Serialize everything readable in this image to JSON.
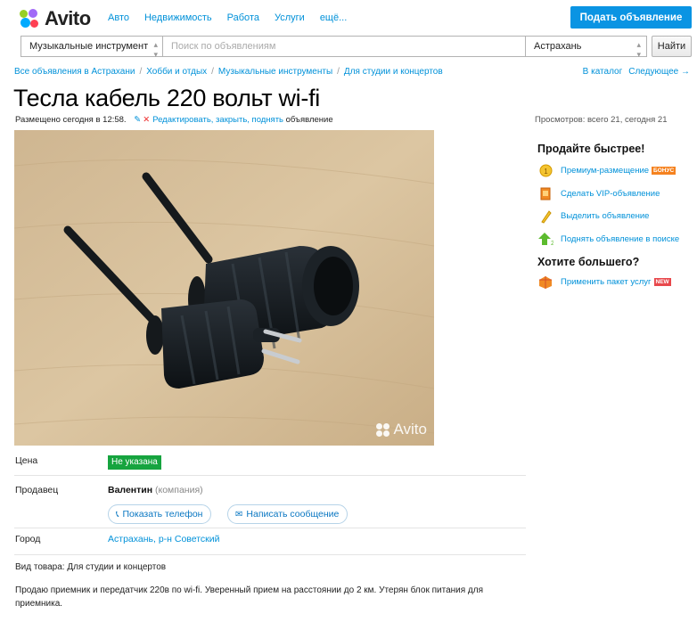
{
  "header": {
    "logo_text": "Avito",
    "nav": [
      "Авто",
      "Недвижимость",
      "Работа",
      "Услуги",
      "ещё..."
    ],
    "post_button": "Подать объявление",
    "colors": {
      "accent": "#0a94e3",
      "link": "#0091d9"
    }
  },
  "search": {
    "category": "Музыкальные инструмент",
    "placeholder": "Поиск по объявлениям",
    "city": "Астрахань",
    "find_button": "Найти"
  },
  "breadcrumbs": [
    "Все объявления в Астрахани",
    "Хобби и отдых",
    "Музыкальные инструменты",
    "Для студии и концертов"
  ],
  "catalog_links": {
    "catalog": "В каталог",
    "next": "Следующее →"
  },
  "listing": {
    "title": "Тесла кабель 220 вольт wi-fi",
    "posted": "Размещено сегодня в 12:58.",
    "edit_link": "Редактировать, закрыть, поднять",
    "edit_suffix": "объявление",
    "views": "Просмотров: всего 21, сегодня 21",
    "photo_watermark": "Avito"
  },
  "sidebar": {
    "sell_faster_title": "Продайте быстрее!",
    "items": [
      {
        "label": "Премиум-размещение",
        "badge": "БОНУС",
        "icon": "premium-coin-icon"
      },
      {
        "label": "Сделать VIP-объявление",
        "badge": "",
        "icon": "vip-icon"
      },
      {
        "label": "Выделить объявление",
        "badge": "",
        "icon": "highlight-pencil-icon"
      },
      {
        "label": "Поднять объявление в поиске",
        "badge": "",
        "icon": "arrow-up-icon"
      }
    ],
    "more_title": "Хотите большего?",
    "more_item": {
      "label": "Применить пакет услуг",
      "badge": "NEW",
      "icon": "package-icon"
    }
  },
  "details": {
    "price_label": "Цена",
    "price_value": "Не указана",
    "seller_label": "Продавец",
    "seller_name": "Валентин",
    "seller_type": "(компания)",
    "show_phone": "Показать телефон",
    "write_message": "Написать сообщение",
    "city_label": "Город",
    "city_value": "Астрахань, р-н Советский"
  },
  "description": {
    "type": "Вид товара: Для студии и концертов",
    "text": "Продаю приемник и передатчик 220в по wi-fi. Уверенный прием на расстоянии до 2 км. Утерян блок питания для приемника."
  }
}
